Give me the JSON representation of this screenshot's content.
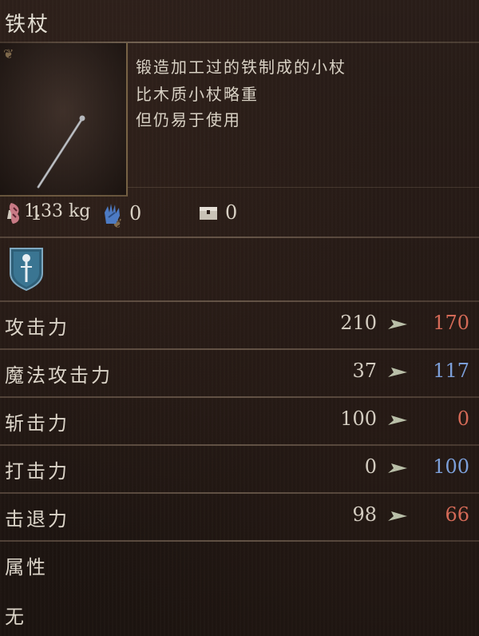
{
  "item": {
    "name": "铁杖",
    "weight": "1.33 kg",
    "description": [
      "锻造加工过的铁制成的小杖",
      "比木质小杖略重",
      "但仍易于使用"
    ],
    "icon": "iron-staff-icon"
  },
  "requirements": [
    {
      "icon": "strength-icon",
      "value": "1"
    },
    {
      "icon": "magic-hand-icon",
      "value": "0"
    },
    {
      "icon": "chest-icon",
      "value": "0"
    }
  ],
  "category_icon": "staff-shield-icon",
  "stats": [
    {
      "label": "攻击力",
      "current": "210",
      "new": "170",
      "new_color": "#d46a57"
    },
    {
      "label": "魔法攻击力",
      "current": "37",
      "new": "117",
      "new_color": "#7c9fd9"
    },
    {
      "label": "斩击力",
      "current": "100",
      "new": "0",
      "new_color": "#d46a57"
    },
    {
      "label": "打击力",
      "current": "0",
      "new": "100",
      "new_color": "#7c9fd9"
    },
    {
      "label": "击退力",
      "current": "98",
      "new": "66",
      "new_color": "#d46a57"
    }
  ],
  "attribute": {
    "label": "属性",
    "value": "无"
  },
  "colors": {
    "decrease": "#d46a57",
    "increase": "#7c9fd9",
    "arrow": "#b9bfa8"
  }
}
